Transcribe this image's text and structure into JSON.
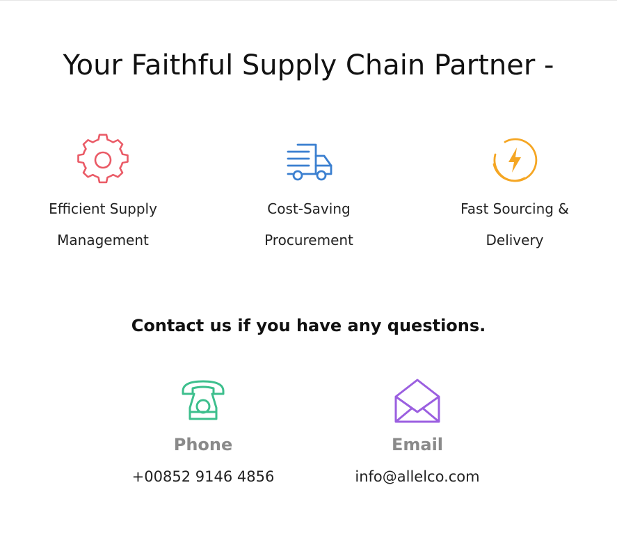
{
  "page": {
    "title": "Your Faithful Supply Chain Partner -"
  },
  "features": [
    {
      "icon": "gear-icon",
      "line1": "Efficient Supply",
      "line2": "Management",
      "color": "#ea5a66"
    },
    {
      "icon": "delivery-truck-icon",
      "line1": "Cost-Saving",
      "line2": "Procurement",
      "color": "#3a7fd0"
    },
    {
      "icon": "lightning-icon",
      "line1": "Fast Sourcing &",
      "line2": "Delivery",
      "color": "#f5a623"
    }
  ],
  "contact": {
    "heading": "Contact us if you have any questions.",
    "items": [
      {
        "icon": "telephone-icon",
        "title": "Phone",
        "value": "+00852 9146 4856",
        "color": "#3dbf8d"
      },
      {
        "icon": "envelope-icon",
        "title": "Email",
        "value": "info@allelco.com",
        "color": "#9b5fe0"
      }
    ]
  }
}
